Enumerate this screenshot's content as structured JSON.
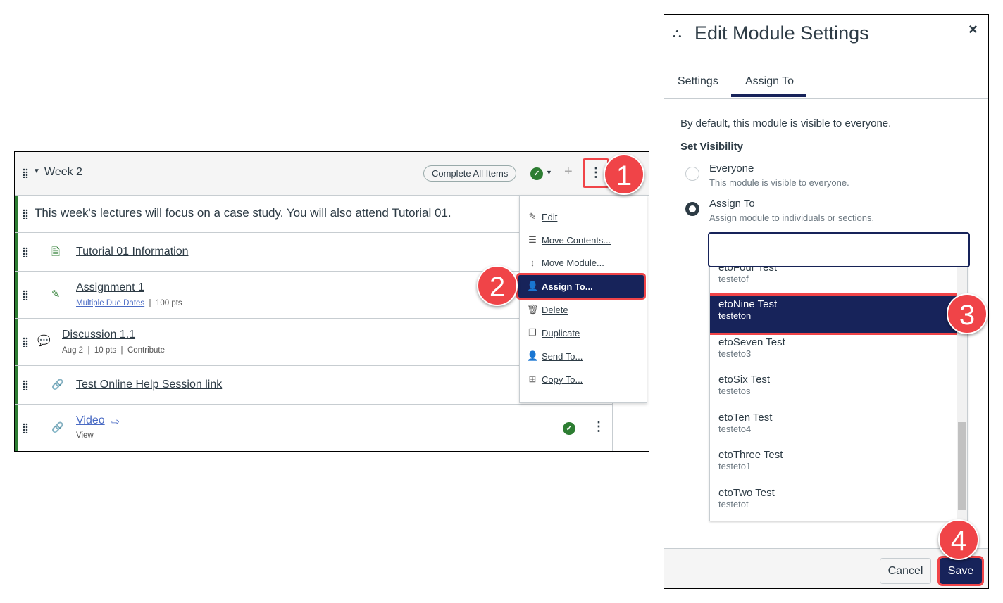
{
  "module": {
    "title": "Week 2",
    "complete_all": "Complete All Items",
    "description": "This week's lectures will focus on a case study. You will also attend Tutorial 01.",
    "items": [
      {
        "title": "Tutorial 01 Information",
        "icon": "page-icon"
      },
      {
        "title": "Assignment 1",
        "icon": "assignment-icon",
        "due": "Multiple Due Dates",
        "pts": "100 pts"
      },
      {
        "title": "Discussion 1.1",
        "icon": "discussion-icon",
        "date": "Aug 2",
        "pts": "10 pts",
        "req": "Contribute"
      },
      {
        "title": "Test Online Help Session link",
        "icon": "link-icon"
      },
      {
        "title": "Video",
        "icon": "link-icon",
        "req": "View"
      }
    ]
  },
  "menu": {
    "items": [
      "Edit",
      "Move Contents...",
      "Move Module...",
      "Assign To...",
      "Delete",
      "Duplicate",
      "Send To...",
      "Copy To..."
    ]
  },
  "badges": [
    "1",
    "2",
    "3",
    "4"
  ],
  "modal": {
    "title": "Edit Module Settings",
    "close": "×",
    "tabs": [
      "Settings",
      "Assign To"
    ],
    "active_tab": "Assign To",
    "intro": "By default, this module is visible to everyone.",
    "set_visibility": "Set Visibility",
    "radios": [
      {
        "label": "Everyone",
        "desc": "This module is visible to everyone.",
        "checked": false
      },
      {
        "label": "Assign To",
        "desc": "Assign module to individuals or sections.",
        "checked": true
      }
    ],
    "search_value": "",
    "options": [
      {
        "name": "etoFour Test",
        "sub": "testetof"
      },
      {
        "name": "etoNine Test",
        "sub": "testeton",
        "highlighted": true
      },
      {
        "name": "etoSeven Test",
        "sub": "testeto3"
      },
      {
        "name": "etoSix Test",
        "sub": "testetos"
      },
      {
        "name": "etoTen Test",
        "sub": "testeto4"
      },
      {
        "name": "etoThree Test",
        "sub": "testeto1"
      },
      {
        "name": "etoTwo Test",
        "sub": "testetot"
      }
    ],
    "cancel": "Cancel",
    "save": "Save"
  },
  "colors": {
    "accent": "#17235a",
    "annotation": "#f04448",
    "success": "#2d7d32"
  }
}
